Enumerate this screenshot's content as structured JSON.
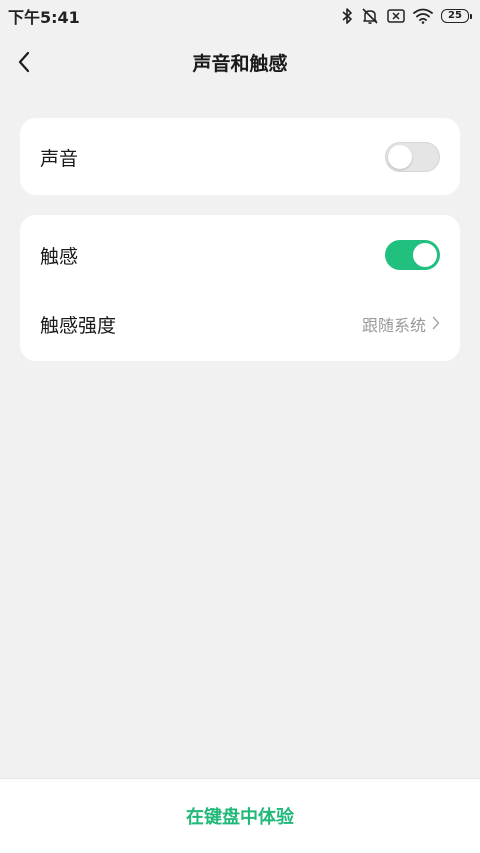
{
  "status_bar": {
    "time": "下午5:41",
    "battery": "25",
    "icons": [
      "bluetooth-icon",
      "mute-icon",
      "sim-off-icon",
      "wifi-icon",
      "battery-icon"
    ]
  },
  "header": {
    "title": "声音和触感",
    "back_icon": "chevron-left-icon"
  },
  "sound_card": {
    "label": "声音",
    "toggle_on": false
  },
  "haptic_card": {
    "haptic_label": "触感",
    "haptic_on": true,
    "intensity_label": "触感强度",
    "intensity_value": "跟随系统"
  },
  "bottom": {
    "try_label": "在键盘中体验"
  },
  "colors": {
    "accent": "#21c07f",
    "background": "#f1f1f1",
    "card": "#ffffff",
    "secondary_text": "#999999"
  }
}
